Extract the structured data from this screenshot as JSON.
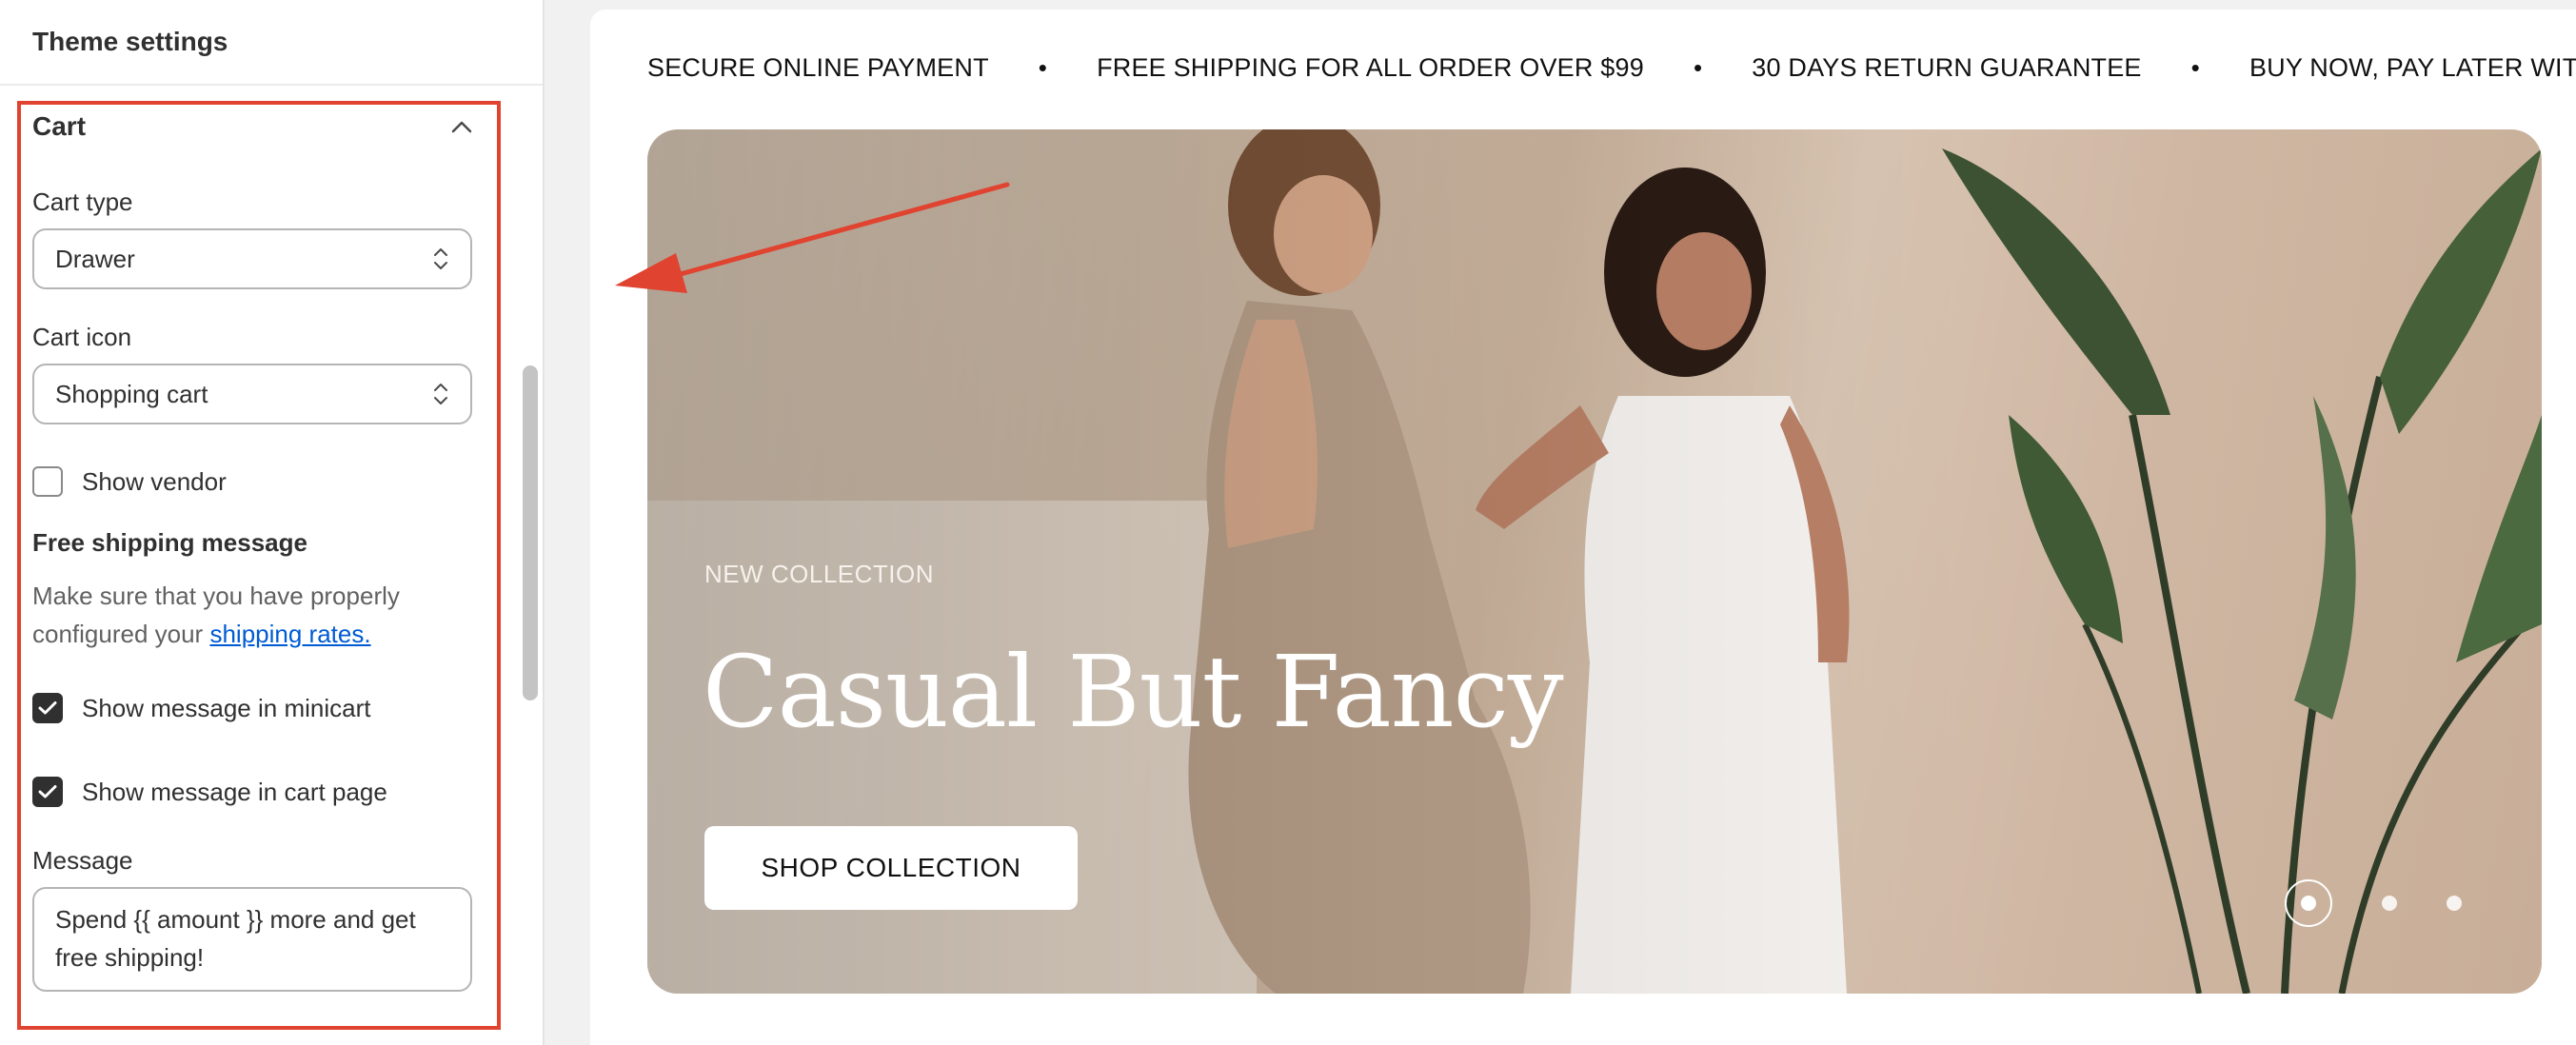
{
  "panel": {
    "title": "Theme settings",
    "section": {
      "title": "Cart",
      "cart_type": {
        "label": "Cart type",
        "value": "Drawer"
      },
      "cart_icon": {
        "label": "Cart icon",
        "value": "Shopping cart"
      },
      "show_vendor": {
        "label": "Show vendor",
        "checked": false
      },
      "free_shipping": {
        "title": "Free shipping message",
        "help_prefix": "Make sure that you have properly configured your",
        "help_link": "shipping rates."
      },
      "show_minicart": {
        "label": "Show message in minicart",
        "checked": true
      },
      "show_cart_page": {
        "label": "Show message in cart page",
        "checked": true
      },
      "message": {
        "label": "Message",
        "value": "Spend {{ amount }} more and get free shipping!"
      }
    }
  },
  "preview": {
    "ticker": [
      "SECURE ONLINE PAYMENT",
      "FREE SHIPPING FOR ALL ORDER OVER $99",
      "30 DAYS RETURN GUARANTEE",
      "BUY NOW, PAY LATER WIT"
    ],
    "ticker_separator": "•",
    "hero": {
      "eyebrow": "NEW COLLECTION",
      "title": "Casual But Fancy",
      "button": "SHOP COLLECTION",
      "slides": 3,
      "active_slide": 1
    }
  },
  "colors": {
    "highlight": "#e0432f",
    "link": "#005bd3"
  }
}
